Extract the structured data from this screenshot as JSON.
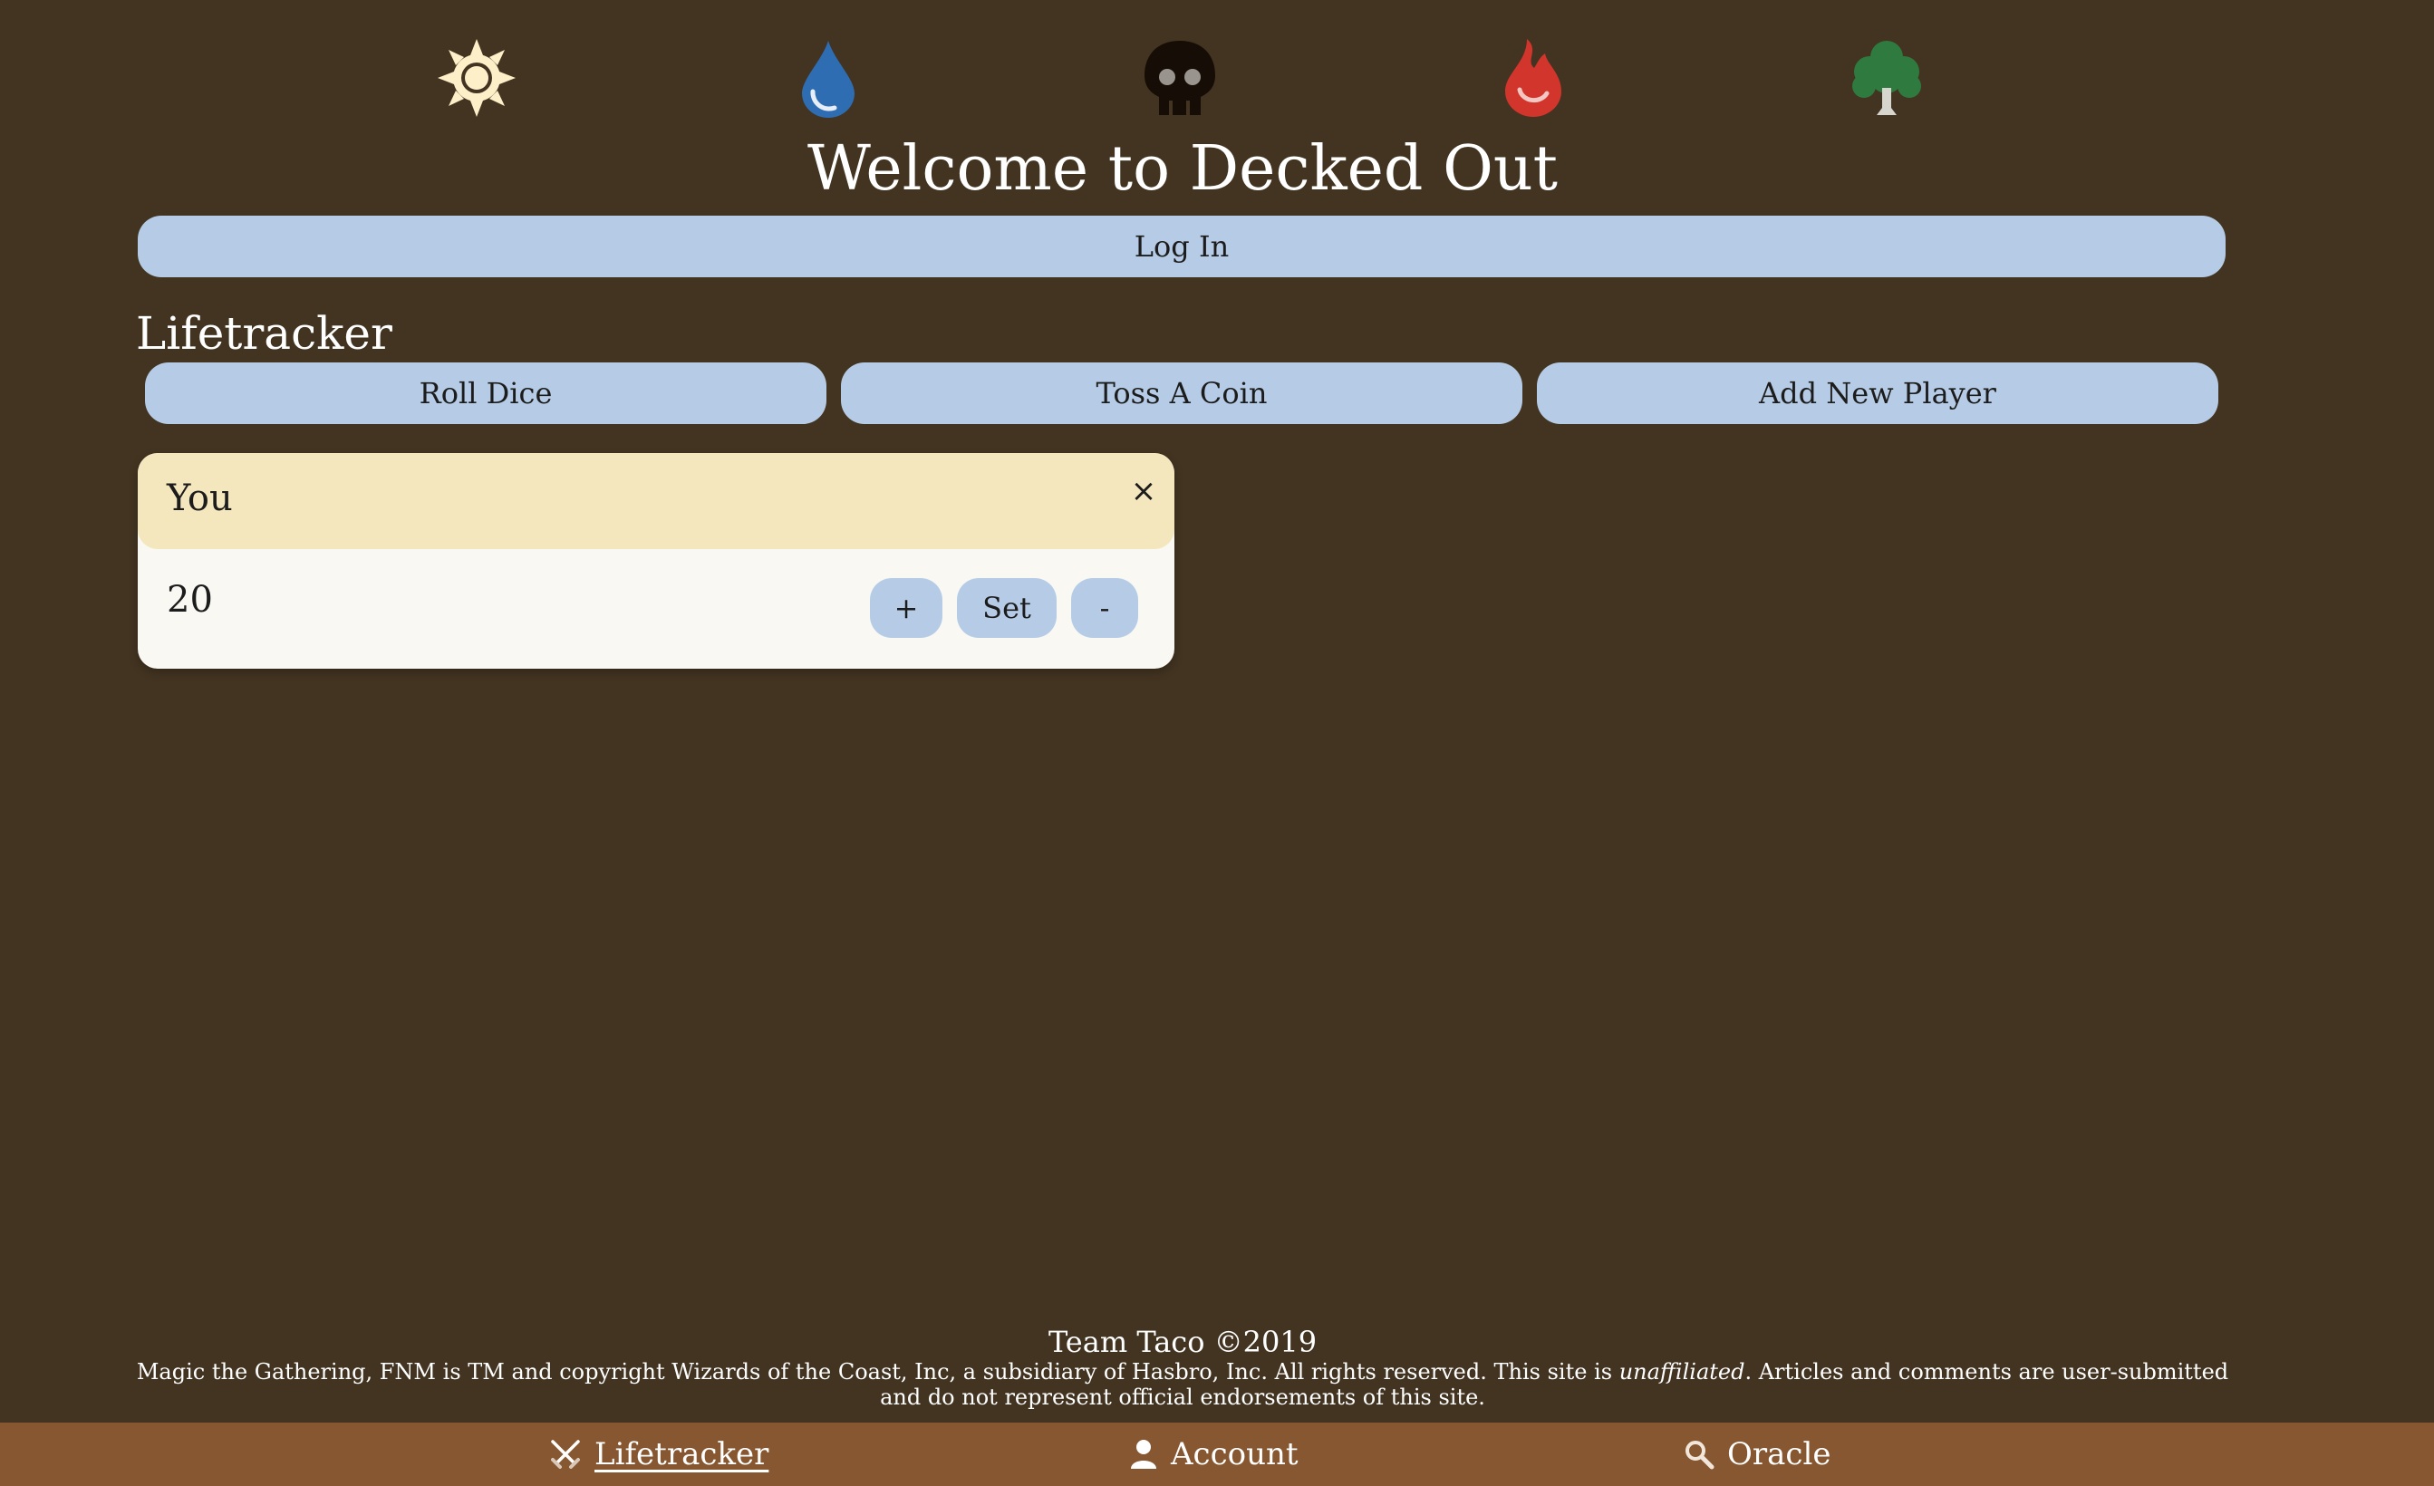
{
  "mana_icons": [
    {
      "name": "white-sun-icon",
      "color": "#fdf0c9"
    },
    {
      "name": "blue-drop-icon",
      "color": "#2f6db3"
    },
    {
      "name": "black-skull-icon",
      "color": "#160d06"
    },
    {
      "name": "red-fire-icon",
      "color": "#d2352c"
    },
    {
      "name": "green-tree-icon",
      "color": "#2f7a3f"
    }
  ],
  "header": {
    "title": "Welcome to Decked Out",
    "login_label": "Log In"
  },
  "lifetracker": {
    "title": "Lifetracker",
    "actions": {
      "roll_dice": "Roll Dice",
      "toss_coin": "Toss A Coin",
      "add_player": "Add New Player"
    },
    "players": [
      {
        "name": "You",
        "close": "×",
        "life": "20",
        "plus_label": "+",
        "set_label": "Set",
        "minus_label": "-"
      }
    ]
  },
  "footer": {
    "team": "Team Taco ©2019",
    "legal_before": "Magic the Gathering, FNM is TM and copyright Wizards of the Coast, Inc, a subsidiary of Hasbro, Inc. All rights reserved. This site is ",
    "legal_emph": "unaffiliated",
    "legal_after": ". Articles and comments are user-submitted and do not represent official endorsements of this site."
  },
  "nav": {
    "items": [
      {
        "label": "Lifetracker",
        "icon": "crossed-swords-icon",
        "active": true
      },
      {
        "label": "Account",
        "icon": "user-icon",
        "active": false
      },
      {
        "label": "Oracle",
        "icon": "magnifier-icon",
        "active": false
      }
    ]
  },
  "colors": {
    "background": "#433421",
    "button": "#b6cce6",
    "card_header": "#f5e7bd",
    "card_body": "#f9f8f3",
    "nav_bar": "#865730"
  }
}
